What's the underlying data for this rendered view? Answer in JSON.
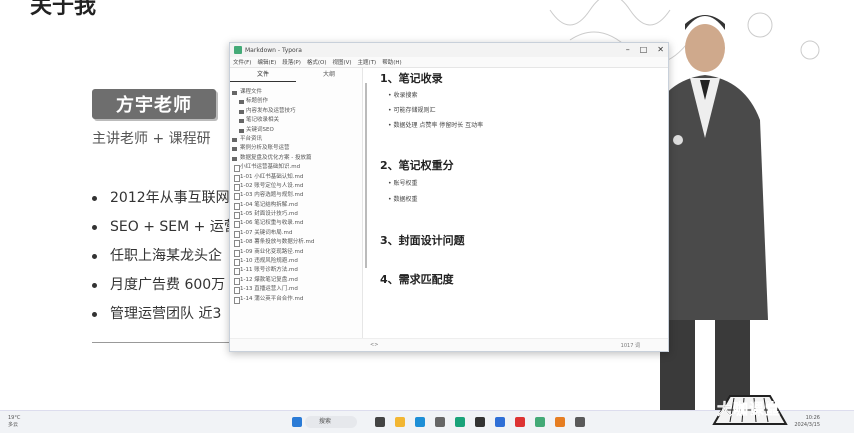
{
  "slide": {
    "title": "关于我",
    "badge": "方宇老师",
    "subtitle": "主讲老师 + 课程研",
    "bullets": [
      "2012年从事互联网",
      "SEO + SEM + 运营",
      "任职上海某龙头企",
      "月度广告费 600万",
      "管理运营团队 近3"
    ]
  },
  "window": {
    "title": "Markdown - Typora",
    "menu": [
      "文件(F)",
      "编辑(E)",
      "段落(P)",
      "格式(O)",
      "视图(V)",
      "主题(T)",
      "帮助(H)"
    ],
    "tabs": [
      "文件",
      "大纲"
    ],
    "tree": [
      {
        "label": "课程文件",
        "kind": "folder",
        "level": 0
      },
      {
        "label": "标题创作",
        "kind": "folder",
        "level": 1
      },
      {
        "label": "内容发布及运营技巧",
        "kind": "folder",
        "level": 1
      },
      {
        "label": "笔记收录相关",
        "kind": "folder",
        "level": 1
      },
      {
        "label": "关键词SEO",
        "kind": "folder",
        "level": 1
      },
      {
        "label": "平台资讯",
        "kind": "folder",
        "level": 0
      },
      {
        "label": "案例分析及账号运营",
        "kind": "folder",
        "level": 0
      },
      {
        "label": "数据复盘及优化方案 - 投放篇",
        "kind": "folder",
        "level": 0
      },
      {
        "label": "小红书运营基础知识.md",
        "kind": "file",
        "level": 0
      },
      {
        "label": "1-01 小红书基础认知.md",
        "kind": "file",
        "level": 0
      },
      {
        "label": "1-02 账号定位与人设.md",
        "kind": "file",
        "level": 0
      },
      {
        "label": "1-03 内容选题与规划.md",
        "kind": "file",
        "level": 0
      },
      {
        "label": "1-04 笔记结构拆解.md",
        "kind": "file",
        "level": 0
      },
      {
        "label": "1-05 封面设计技巧.md",
        "kind": "file",
        "level": 0
      },
      {
        "label": "1-06 笔记权重与收录.md",
        "kind": "file",
        "level": 0
      },
      {
        "label": "1-07 关键词布局.md",
        "kind": "file",
        "level": 0
      },
      {
        "label": "1-08 薯条投放与数据分析.md",
        "kind": "file",
        "level": 0
      },
      {
        "label": "1-09 商业化变现路径.md",
        "kind": "file",
        "level": 0
      },
      {
        "label": "1-10 违规风险规避.md",
        "kind": "file",
        "level": 0
      },
      {
        "label": "1-11 账号诊断方法.md",
        "kind": "file",
        "level": 0
      },
      {
        "label": "1-12 爆款笔记复盘.md",
        "kind": "file",
        "level": 0
      },
      {
        "label": "1-13 直播运营入门.md",
        "kind": "file",
        "level": 0
      },
      {
        "label": "1-14 蒲公英平台合作.md",
        "kind": "file",
        "level": 0
      }
    ],
    "doc": {
      "h1": "1、笔记收录",
      "h1_items": [
        "收录搜索",
        "可能存储规则汇",
        "数据处理  点赞率  停留时长  互动率"
      ],
      "h2": "2、笔记权重分",
      "h2_items": [
        "账号权重",
        "数据权重"
      ],
      "h3": "3、封面设计问题",
      "h4": "4、需求匹配度"
    },
    "status_left": "<>",
    "status_right": "1017 词"
  },
  "taskbar": {
    "weather_temp": "19°C",
    "weather_desc": "多云",
    "search": "搜索",
    "time": "10:26",
    "date": "2024/3/15"
  },
  "logo": "大咖课堂"
}
